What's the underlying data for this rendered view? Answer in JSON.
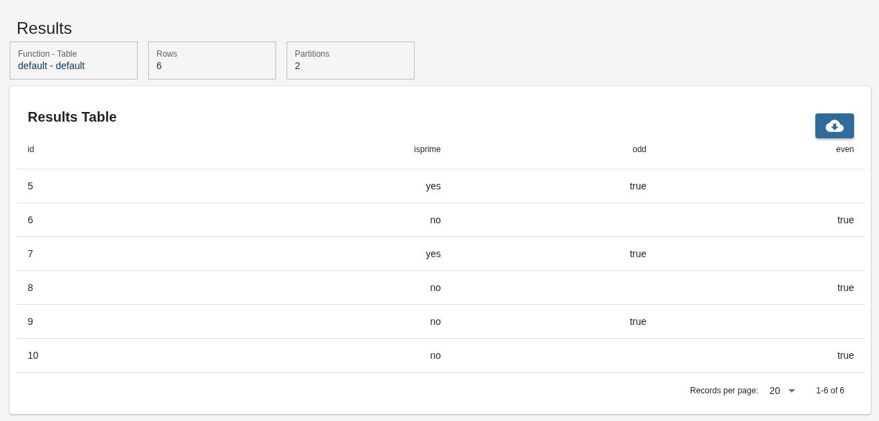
{
  "page_title": "Results",
  "stats": [
    {
      "label": "Function - Table",
      "value": "default - default"
    },
    {
      "label": "Rows",
      "value": "6"
    },
    {
      "label": "Partitions",
      "value": "2"
    }
  ],
  "table": {
    "title": "Results Table",
    "columns": [
      "id",
      "isprime",
      "odd",
      "even"
    ],
    "rows": [
      [
        "5",
        "yes",
        "true",
        ""
      ],
      [
        "6",
        "no",
        "",
        "true"
      ],
      [
        "7",
        "yes",
        "true",
        ""
      ],
      [
        "8",
        "no",
        "",
        "true"
      ],
      [
        "9",
        "no",
        "true",
        ""
      ],
      [
        "10",
        "no",
        "",
        "true"
      ]
    ]
  },
  "pagination": {
    "label": "Records per page:",
    "per_page": "20",
    "range": "1-6 of 6"
  }
}
